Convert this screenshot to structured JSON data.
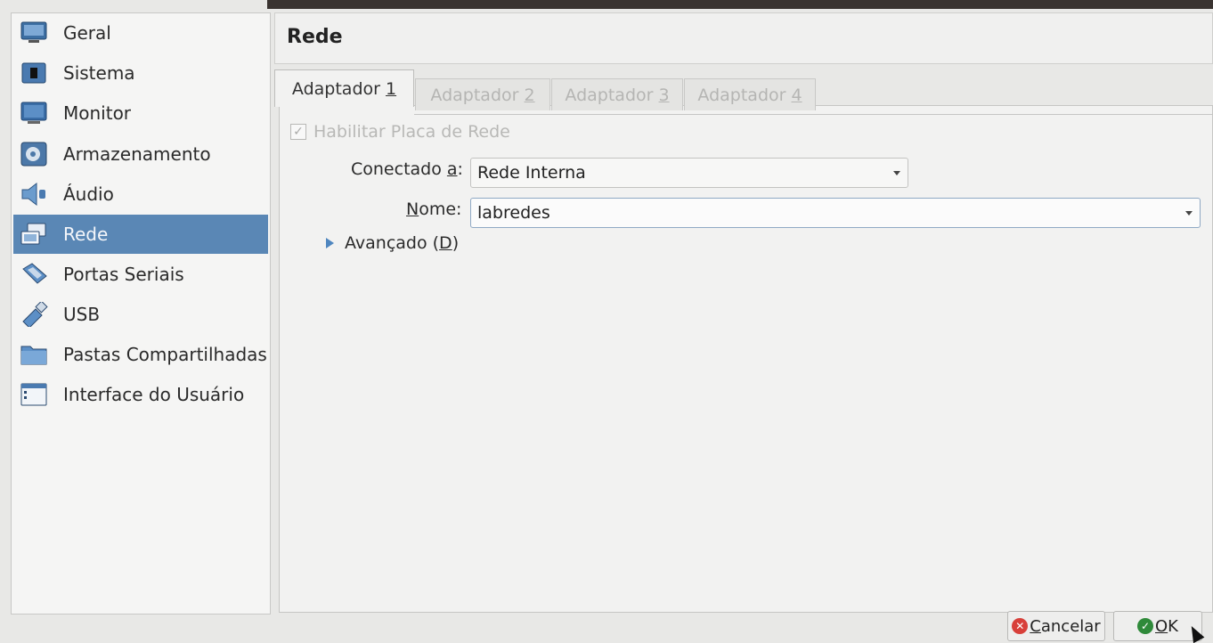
{
  "sidebar": {
    "items": [
      {
        "label": "Geral",
        "icon": "monitor-general-icon"
      },
      {
        "label": "Sistema",
        "icon": "chip-icon"
      },
      {
        "label": "Monitor",
        "icon": "display-icon"
      },
      {
        "label": "Armazenamento",
        "icon": "disk-icon"
      },
      {
        "label": "Áudio",
        "icon": "speaker-icon"
      },
      {
        "label": "Rede",
        "icon": "network-icon",
        "selected": true
      },
      {
        "label": "Portas Seriais",
        "icon": "serial-port-icon"
      },
      {
        "label": "USB",
        "icon": "usb-icon"
      },
      {
        "label": "Pastas Compartilhadas",
        "icon": "folder-icon"
      },
      {
        "label": "Interface do Usuário",
        "icon": "user-interface-icon"
      }
    ]
  },
  "panel": {
    "title": "Rede"
  },
  "tabs": [
    {
      "label": "Adaptador ",
      "mnemonic": "1",
      "active": true
    },
    {
      "label": "Adaptador ",
      "mnemonic": "2",
      "active": false
    },
    {
      "label": "Adaptador ",
      "mnemonic": "3",
      "active": false
    },
    {
      "label": "Adaptador ",
      "mnemonic": "4",
      "active": false
    }
  ],
  "adapter": {
    "enable_label": "Habilitar Placa de Rede",
    "enable_checked": true,
    "attached_label_pre": "Conectado ",
    "attached_label_mnemonic": "a",
    "attached_label_post": ":",
    "attached_value": "Rede Interna",
    "name_label_mnemonic": "N",
    "name_label_post": "ome:",
    "name_value": "labredes",
    "advanced_pre": "Avançado (",
    "advanced_mnemonic": "D",
    "advanced_post": ")"
  },
  "footer": {
    "cancel_mnemonic": "C",
    "cancel_rest": "ancelar",
    "ok_mnemonic": "O",
    "ok_rest": "K"
  },
  "colors": {
    "selection": "#5a87b5",
    "cancel_icon": "#d8403a",
    "ok_icon": "#2f8a3a"
  }
}
